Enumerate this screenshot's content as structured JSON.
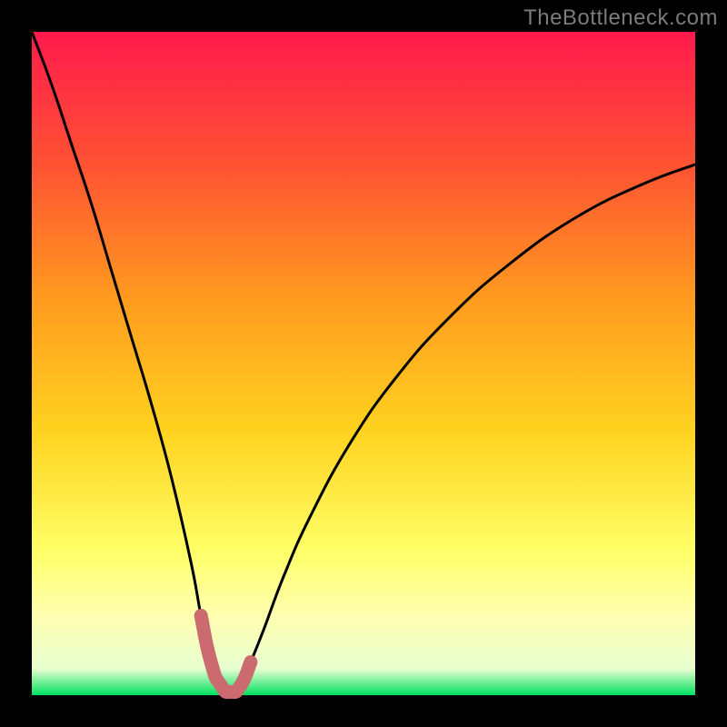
{
  "watermark": "TheBottleneck.com",
  "colors": {
    "frame_bg": "#000000",
    "curve_stroke": "#000000",
    "highlight_stroke": "#cc6b6f",
    "watermark_text": "#7b7b7b"
  },
  "chart_data": {
    "type": "line",
    "title": "",
    "xlabel": "",
    "ylabel": "",
    "xlim": [
      0,
      100
    ],
    "ylim": [
      0,
      100
    ],
    "gradient_stops": [
      {
        "offset": 0,
        "color": "#ff1a4d"
      },
      {
        "offset": 20,
        "color": "#ff5233"
      },
      {
        "offset": 40,
        "color": "#ff9a1f"
      },
      {
        "offset": 60,
        "color": "#ffd21f"
      },
      {
        "offset": 78,
        "color": "#ffff66"
      },
      {
        "offset": 88,
        "color": "#ffffb0"
      },
      {
        "offset": 96,
        "color": "#e8ffd0"
      },
      {
        "offset": 100,
        "color": "#00e060"
      }
    ],
    "series": [
      {
        "name": "bottleneck-curve",
        "x": [
          0,
          3,
          6,
          9,
          12,
          15,
          18,
          21,
          24,
          25.5,
          27,
          28.5,
          30,
          31.5,
          33,
          35,
          38,
          42,
          48,
          55,
          63,
          72,
          82,
          92,
          100
        ],
        "y": [
          100,
          92,
          83,
          74,
          64,
          54,
          44,
          33,
          20,
          12,
          5,
          1.5,
          0.5,
          1.5,
          5,
          10,
          18,
          27,
          38,
          48,
          57,
          65,
          72,
          77,
          80
        ]
      }
    ],
    "highlight": {
      "name": "trough-marker",
      "x": [
        25.5,
        27,
        28.5,
        30,
        31.5,
        33
      ],
      "y": [
        12,
        5,
        1.5,
        0.5,
        1.5,
        5
      ]
    }
  }
}
